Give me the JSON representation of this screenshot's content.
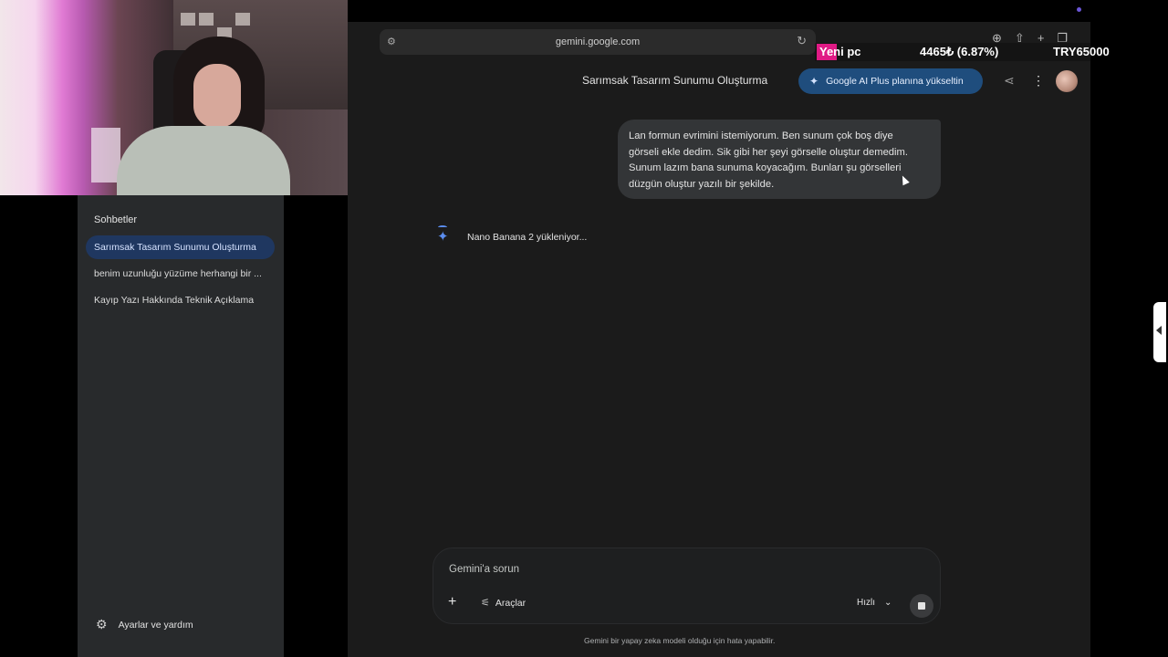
{
  "browser": {
    "url": "gemini.google.com"
  },
  "sidebar": {
    "heading": "Sohbetler",
    "chats": [
      {
        "label": "Sarımsak Tasarım Sunumu Oluşturma",
        "active": true
      },
      {
        "label": "benim uzunluğu yüzüme herhangi bir ...",
        "active": false
      },
      {
        "label": "Kayıp Yazı Hakkında Teknik Açıklama",
        "active": false
      }
    ],
    "settings_label": "Ayarlar ve yardım"
  },
  "header": {
    "title": "Sarımsak Tasarım Sunumu Oluşturma",
    "upgrade_label": "Google AI Plus planına yükseltin"
  },
  "conversation": {
    "user_message_lines": [
      "Lan formun evrimini istemiyorum. Ben sunum çok boş diye",
      "görseli ekle dedim. Sik gibi her şeyi görselle oluştur demedim.",
      "Sunum lazım bana sunuma koyacağım. Bunları şu görselleri",
      "düzgün oluştur yazılı bir şekilde."
    ],
    "loading_text": "Nano Banana 2 yükleniyor..."
  },
  "composer": {
    "placeholder": "Gemini'a sorun",
    "tools_label": "Araçlar",
    "speed_label": "Hızlı"
  },
  "disclaimer": "Gemini bir yapay zeka modeli olduğu için hata yapabilir.",
  "overlay": {
    "goal_name": "Yeni pc",
    "progress_text": "4465₺ (6.87%)",
    "goal_target": "TRY65000"
  },
  "colors": {
    "accent": "#1f4d7d",
    "active_chat": "#1f3760",
    "spark": "#5b8def",
    "ticker_pink": "#e01a85"
  }
}
